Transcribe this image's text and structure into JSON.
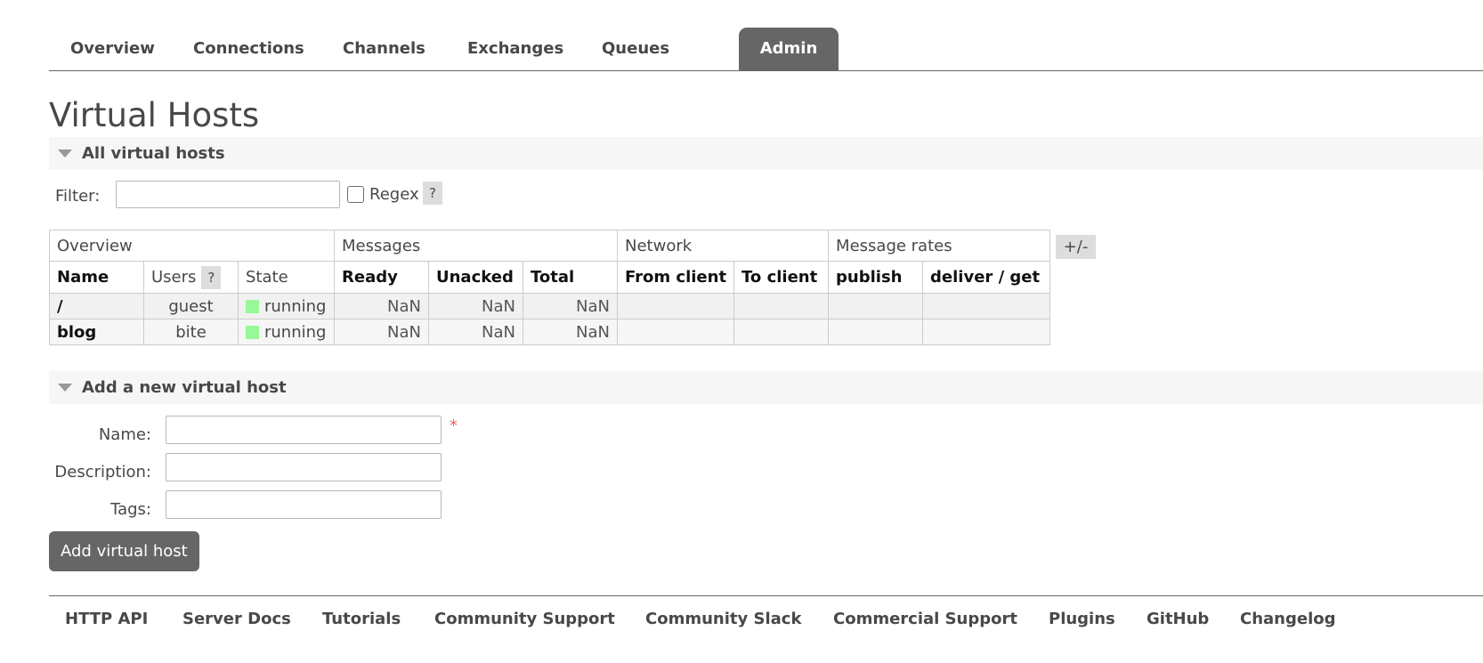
{
  "nav": {
    "tabs": [
      {
        "label": "Overview"
      },
      {
        "label": "Connections"
      },
      {
        "label": "Channels"
      },
      {
        "label": "Exchanges"
      },
      {
        "label": "Queues"
      },
      {
        "label": "Admin",
        "active": true
      }
    ]
  },
  "page": {
    "title": "Virtual Hosts"
  },
  "all_vhosts": {
    "section_title": "All virtual hosts",
    "filter_label": "Filter:",
    "filter_value": "",
    "regex_label": "Regex",
    "regex_checked": false,
    "help_label": "?",
    "table": {
      "groups": [
        "Overview",
        "Messages",
        "Network",
        "Message rates"
      ],
      "columns": [
        "Name",
        "Users",
        "State",
        "Ready",
        "Unacked",
        "Total",
        "From client",
        "To client",
        "publish",
        "deliver / get"
      ],
      "users_help": "?",
      "rows": [
        {
          "name": "/",
          "users": "guest",
          "state": "running",
          "ready": "NaN",
          "unacked": "NaN",
          "total": "NaN",
          "from_client": "",
          "to_client": "",
          "publish": "",
          "deliver_get": ""
        },
        {
          "name": "blog",
          "users": "bite",
          "state": "running",
          "ready": "NaN",
          "unacked": "NaN",
          "total": "NaN",
          "from_client": "",
          "to_client": "",
          "publish": "",
          "deliver_get": ""
        }
      ]
    },
    "columns_toggle": "+/-"
  },
  "add_vhost": {
    "section_title": "Add a new virtual host",
    "name_label": "Name:",
    "description_label": "Description:",
    "tags_label": "Tags:",
    "required_mark": "*",
    "button_label": "Add virtual host"
  },
  "footer": {
    "links": [
      "HTTP API",
      "Server Docs",
      "Tutorials",
      "Community Support",
      "Community Slack",
      "Commercial Support",
      "Plugins",
      "GitHub",
      "Changelog"
    ]
  },
  "colors": {
    "accent": "#666666",
    "running": "#98f898",
    "required": "#e8625c"
  }
}
